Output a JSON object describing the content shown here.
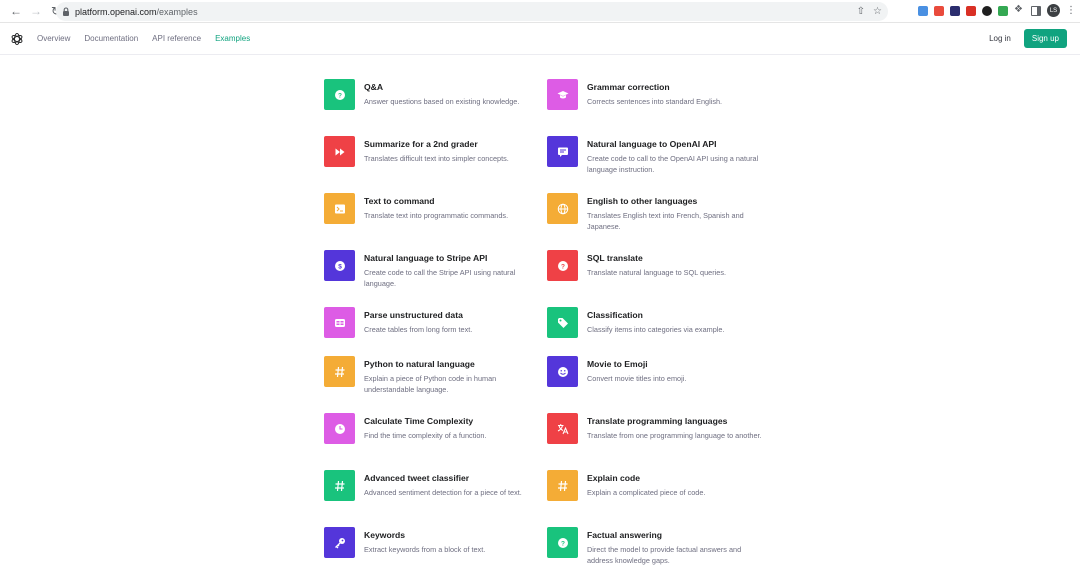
{
  "browser": {
    "url_host": "platform.openai.com",
    "url_path": "/examples",
    "profile_initials": "LS"
  },
  "header": {
    "nav": [
      "Overview",
      "Documentation",
      "API reference",
      "Examples"
    ],
    "active_nav": "Examples",
    "login_label": "Log in",
    "signup_label": "Sign up",
    "accent_color": "#10a37f"
  },
  "examples": [
    {
      "title": "Q&A",
      "desc": "Answer questions based on existing knowledge.",
      "color": "#19c37d",
      "icon": "question-icon"
    },
    {
      "title": "Grammar correction",
      "desc": "Corrects sentences into standard English.",
      "color": "#dd5ce5",
      "icon": "graduation-cap-icon"
    },
    {
      "title": "Summarize for a 2nd grader",
      "desc": "Translates difficult text into simpler concepts.",
      "color": "#ef4146",
      "icon": "fast-forward-icon"
    },
    {
      "title": "Natural language to OpenAI API",
      "desc": "Create code to call to the OpenAI API using a natural language instruction.",
      "color": "#5436da",
      "icon": "chat-bubble-icon"
    },
    {
      "title": "Text to command",
      "desc": "Translate text into programmatic commands.",
      "color": "#f4ac36",
      "icon": "terminal-icon"
    },
    {
      "title": "English to other languages",
      "desc": "Translates English text into French, Spanish and Japanese.",
      "color": "#f4ac36",
      "icon": "globe-icon"
    },
    {
      "title": "Natural language to Stripe API",
      "desc": "Create code to call the Stripe API using natural language.",
      "color": "#5436da",
      "icon": "dollar-icon"
    },
    {
      "title": "SQL translate",
      "desc": "Translate natural language to SQL queries.",
      "color": "#ef4146",
      "icon": "question-icon"
    },
    {
      "title": "Parse unstructured data",
      "desc": "Create tables from long form text.",
      "color": "#dd5ce5",
      "icon": "table-icon"
    },
    {
      "title": "Classification",
      "desc": "Classify items into categories via example.",
      "color": "#19c37d",
      "icon": "tag-icon"
    },
    {
      "title": "Python to natural language",
      "desc": "Explain a piece of Python code in human understandable language.",
      "color": "#f4ac36",
      "icon": "hash-icon"
    },
    {
      "title": "Movie to Emoji",
      "desc": "Convert movie titles into emoji.",
      "color": "#5436da",
      "icon": "smiley-icon"
    },
    {
      "title": "Calculate Time Complexity",
      "desc": "Find the time complexity of a function.",
      "color": "#dd5ce5",
      "icon": "clock-icon"
    },
    {
      "title": "Translate programming languages",
      "desc": "Translate from one programming language to another.",
      "color": "#ef4146",
      "icon": "translate-icon"
    },
    {
      "title": "Advanced tweet classifier",
      "desc": "Advanced sentiment detection for a piece of text.",
      "color": "#19c37d",
      "icon": "hash-icon"
    },
    {
      "title": "Explain code",
      "desc": "Explain a complicated piece of code.",
      "color": "#f4ac36",
      "icon": "hash-icon"
    },
    {
      "title": "Keywords",
      "desc": "Extract keywords from a block of text.",
      "color": "#5436da",
      "icon": "key-icon"
    },
    {
      "title": "Factual answering",
      "desc": "Direct the model to provide factual answers and address knowledge gaps.",
      "color": "#19c37d",
      "icon": "question-icon"
    }
  ]
}
